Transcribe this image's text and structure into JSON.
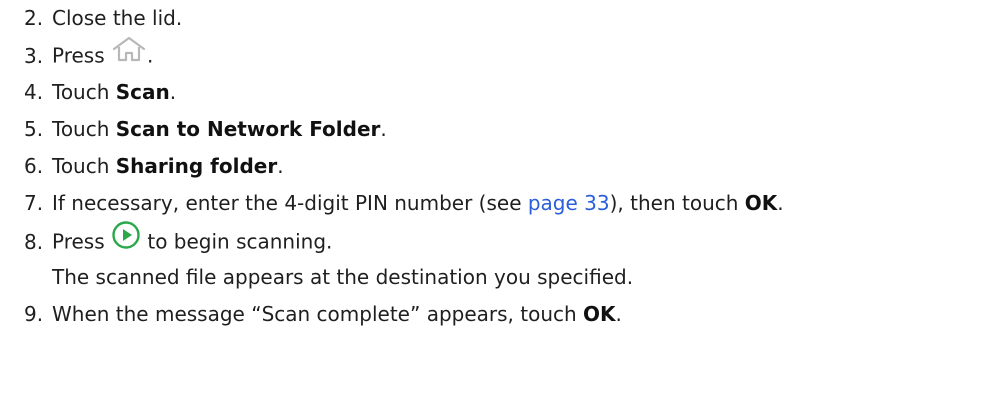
{
  "steps": [
    {
      "num": "2.",
      "text": "Close the lid."
    },
    {
      "num": "3.",
      "before": "Press ",
      "icon": "home-icon",
      "after": "."
    },
    {
      "num": "4.",
      "before": "Touch ",
      "bold": "Scan",
      "after": "."
    },
    {
      "num": "5.",
      "before": "Touch ",
      "bold": "Scan to Network Folder",
      "after": "."
    },
    {
      "num": "6.",
      "before": "Touch ",
      "bold": "Sharing folder",
      "after": "."
    },
    {
      "num": "7.",
      "before": "If necessary, enter the 4-digit PIN number (see ",
      "link": "page 33",
      "mid": "), then touch ",
      "bold": "OK",
      "after": "."
    },
    {
      "num": "8.",
      "before": "Press ",
      "icon": "start-play-icon",
      "after": " to begin scanning."
    },
    {
      "continuation": "The scanned file appears at the destination you specified."
    },
    {
      "num": "9.",
      "before": "When the message “Scan complete” appears, touch ",
      "bold": "OK",
      "after": "."
    }
  ],
  "colors": {
    "text": "#1f1f1f",
    "link": "#2b5fd9",
    "home_icon": "#b8b8b8",
    "start_icon": "#2aa84a"
  }
}
